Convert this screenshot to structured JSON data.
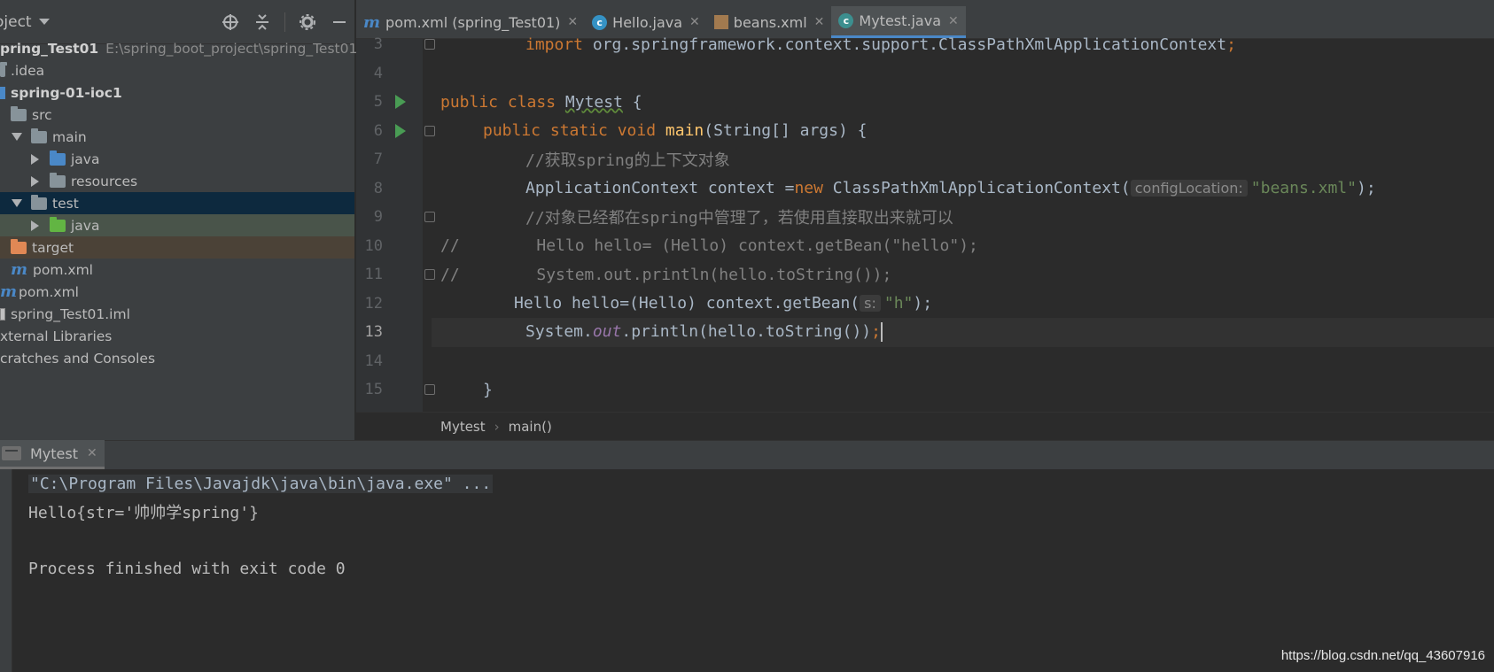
{
  "sidebar": {
    "title": "oject",
    "tree": [
      {
        "label": "pring_Test01",
        "path": "E:\\spring_boot_project\\spring_Test01"
      },
      {
        "label": ".idea"
      },
      {
        "label": "spring-01-ioc1"
      },
      {
        "label": "src"
      },
      {
        "label": "main"
      },
      {
        "label": "java"
      },
      {
        "label": "resources"
      },
      {
        "label": "test"
      },
      {
        "label": "java"
      },
      {
        "label": "target"
      },
      {
        "label": "pom.xml"
      },
      {
        "label": "pom.xml"
      },
      {
        "label": "spring_Test01.iml"
      },
      {
        "label": "xternal Libraries"
      },
      {
        "label": "cratches and Consoles"
      }
    ]
  },
  "tabs": [
    {
      "label": "pom.xml (spring_Test01)",
      "icon": "maven-icon"
    },
    {
      "label": "Hello.java",
      "icon": "class-icon"
    },
    {
      "label": "beans.xml",
      "icon": "xml-icon"
    },
    {
      "label": "Mytest.java",
      "icon": "class-icon",
      "active": true
    }
  ],
  "editor": {
    "lines": [
      {
        "n": "3"
      },
      {
        "n": "4"
      },
      {
        "n": "5"
      },
      {
        "n": "6"
      },
      {
        "n": "7"
      },
      {
        "n": "8"
      },
      {
        "n": "9"
      },
      {
        "n": "10"
      },
      {
        "n": "11"
      },
      {
        "n": "12"
      },
      {
        "n": "13"
      },
      {
        "n": "14"
      },
      {
        "n": "15"
      }
    ],
    "code": {
      "l3_import": "import ",
      "l3_rest": "org.springframework.context.support.ClassPathXmlApplicationContext",
      "l3_semi": ";",
      "l5_public": "public class ",
      "l5_name": "Mytest",
      "l5_rest": " {",
      "l6_mods": "public static void ",
      "l6_main": "main",
      "l6_rest": "(String[] args) {",
      "l7": "//获取spring的上下文对象",
      "l8_a": "ApplicationContext context =",
      "l8_new": "new",
      "l8_b": " ClassPathXmlApplicationContext(",
      "l8_hint": "configLocation:",
      "l8_str": "\"beans.xml\"",
      "l8_end": ");",
      "l9": "//对象已经都在spring中管理了，若使用直接取出来就可以",
      "l10": "//        Hello hello= (Hello) context.getBean(\"hello\");",
      "l11": "//        System.out.println(hello.toString());",
      "l12_a": "Hello hello=(Hello) context.getBean(",
      "l12_hint": "s:",
      "l12_str": "\"h\"",
      "l12_end": ");",
      "l13_a": "System.",
      "l13_out": "out",
      "l13_b": ".println(hello.toString())",
      "l13_semi": ";",
      "l15": "}"
    }
  },
  "breadcrumb": [
    "Mytest",
    "main()"
  ],
  "run": {
    "tab": "Mytest",
    "output": [
      "\"C:\\Program Files\\Javajdk\\java\\bin\\java.exe\" ...",
      "Hello{str='帅帅学spring'}",
      "",
      "Process finished with exit code 0"
    ]
  },
  "watermark": "https://blog.csdn.net/qq_43607916"
}
